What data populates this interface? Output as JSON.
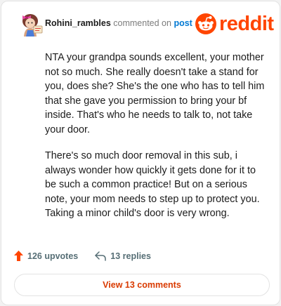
{
  "comment": {
    "username": "Rohini_rambles",
    "action_text": "commented on",
    "post_link": "post",
    "paragraphs": [
      "NTA your grandpa sounds excellent, your mother not so much. She really doesn't take a stand for you, does she? She's the one who has to tell him that she gave you permission to bring your bf inside. That's who he needs to talk to, not take your door.",
      "There's so much door removal in this sub, i always wonder how quickly it gets done for it to be such a common practice! But on a serious note, your mom needs to step up to protect you. Taking a minor child's door is very wrong."
    ]
  },
  "brand": {
    "name": "reddit",
    "color": "#ff4500"
  },
  "stats": {
    "upvotes": "126 upvotes",
    "replies": "13 replies"
  },
  "view_button": "View 13 comments",
  "colors": {
    "accent": "#ff4500",
    "link": "#0079d3",
    "button_text": "#d93a00"
  }
}
